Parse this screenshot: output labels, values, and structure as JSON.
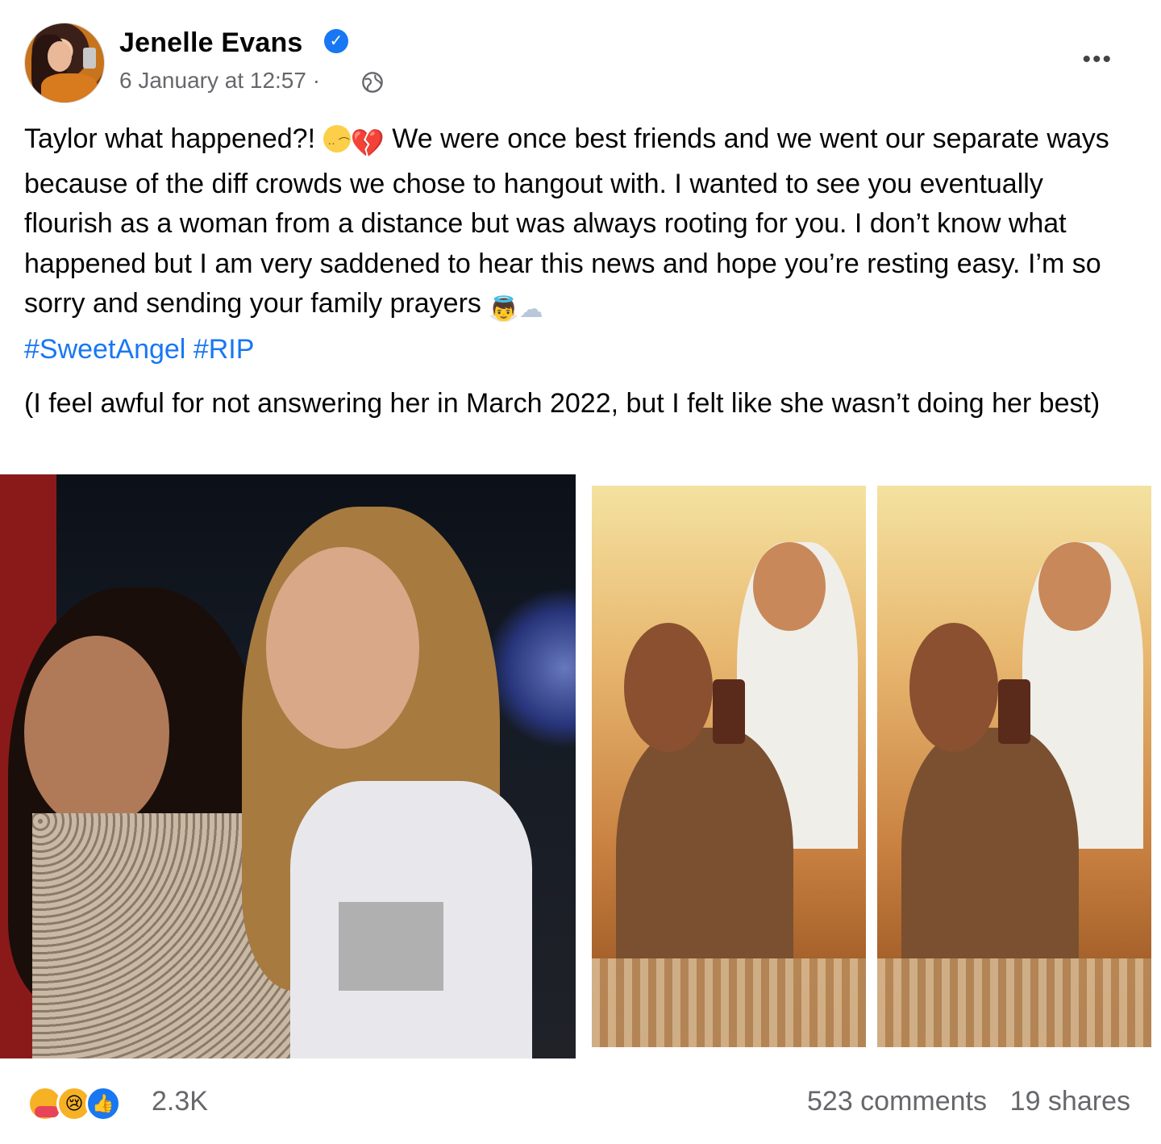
{
  "post": {
    "author": "Jenelle Evans",
    "timestamp": "6 January at 12:57",
    "separator": "·",
    "privacy_icon": "globe-icon",
    "more_icon": "more-options-icon",
    "body": {
      "line1_a": "Taylor what happened?!",
      "line1_b": "We were once best friends and we went our separate ways because of the diff crowds we chose to hangout with. I wanted to see you eventually flourish as a woman from a distance but was always rooting for you. I don’t know what happened but I am very saddened to hear this news and hope you’re resting easy. I’m so sorry and sending your family prayers",
      "hashtags": [
        "#SweetAngel",
        "#RIP"
      ],
      "paragraph2": "(I feel awful for not answering her in March 2022, but I felt like she wasn’t doing her best)"
    },
    "emojis": [
      "frowning-face",
      "broken-heart",
      "baby-angel",
      "cloud"
    ]
  },
  "photos": [
    {
      "name": "photo-1",
      "description": "two women posing at night event"
    },
    {
      "name": "photo-2",
      "description": "mirror selfie"
    },
    {
      "name": "photo-3",
      "description": "mirror selfie"
    }
  ],
  "engagement": {
    "reactions": [
      "care",
      "sad",
      "like"
    ],
    "reaction_count": "2.3K",
    "comments": "523 comments",
    "shares": "19 shares"
  },
  "colors": {
    "link": "#1877f2",
    "muted": "#65676b",
    "verified": "#1877f2"
  }
}
